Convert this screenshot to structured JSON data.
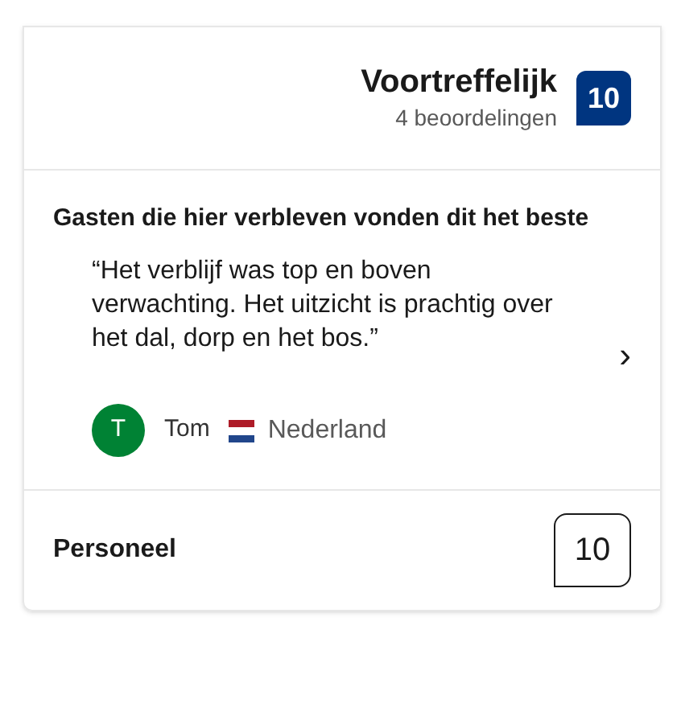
{
  "summary": {
    "label": "Voortreffelijk",
    "reviews": "4 beoordelingen",
    "score": "10"
  },
  "highlight": {
    "heading": "Gasten die hier verbleven vonden dit het beste",
    "quote": "“Het verblijf was top en boven verwachting. Het uitzicht is prachtig over het dal, dorp en het bos.”",
    "chevron": "›",
    "reviewer": {
      "initial": "T",
      "name": "Tom",
      "country": "Nederland",
      "color": "#008234"
    }
  },
  "categories": [
    {
      "name": "Personeel",
      "score": "10"
    }
  ]
}
